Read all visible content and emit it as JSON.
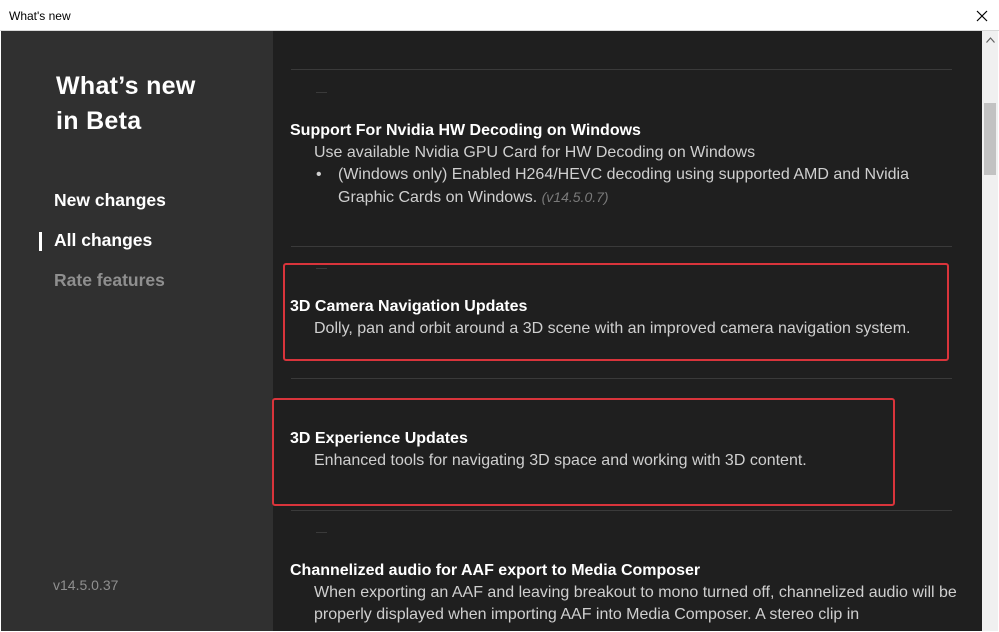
{
  "window": {
    "title": "What's new",
    "close_glyph": "✕"
  },
  "sidebar": {
    "heading_line1": "What’s new",
    "heading_line2": "in Beta",
    "nav": [
      {
        "label": "New changes",
        "active": false
      },
      {
        "label": "All changes",
        "active": true
      },
      {
        "label": "Rate features",
        "active": false
      }
    ],
    "version": "v14.5.0.37"
  },
  "sections": [
    {
      "title": "Support For Nvidia HW Decoding on Windows",
      "description": "Use available Nvidia GPU Card for HW Decoding on Windows",
      "bullet": "(Windows only) Enabled H264/HEVC decoding using supported AMD and Nvidia Graphic Cards on Windows.",
      "bullet_version": "(v14.5.0.7)"
    },
    {
      "title": "3D Camera Navigation Updates",
      "description": "Dolly, pan and orbit around a 3D scene with an improved camera navigation system."
    },
    {
      "title": "3D Experience Updates",
      "description": "Enhanced tools for navigating 3D space and working with 3D content."
    },
    {
      "title": "Channelized audio for AAF export to Media Composer",
      "description": "When exporting an AAF and leaving breakout to mono turned off, channelized audio will be properly displayed when importing AAF into Media Composer. A stereo clip in"
    }
  ],
  "colors": {
    "sidebar_bg": "#303030",
    "content_bg": "#1f1f1f",
    "highlight": "#d9343b"
  }
}
